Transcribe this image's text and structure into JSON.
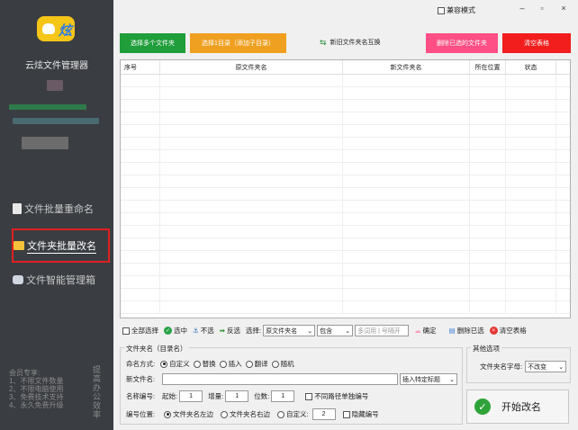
{
  "sidebar": {
    "logo_text": "炫",
    "app_name": "云炫文件管理器",
    "nav": [
      {
        "label": "文件批量重命名"
      },
      {
        "label": "文件夹批量改名"
      },
      {
        "label": "文件智能管理箱"
      }
    ],
    "promo_lines": [
      "会员专享:",
      "1、不限文件数量",
      "2、不限电脑使用",
      "3、免费技术支持",
      "4、永久免费升级"
    ],
    "promo_vertical": "提高办公效率"
  },
  "window": {
    "compat_label": "兼容模式",
    "minimize": "–",
    "maximize": "▫",
    "close": "×"
  },
  "toolbar": {
    "select_folders": "选择多个文件夹",
    "select_dir": "选择1目录（添加子目录）",
    "swap_label": "新旧文件夹名互换",
    "delete_selected": "删除已选的文件夹",
    "clear_table": "清空表格"
  },
  "table": {
    "columns": [
      "序号",
      "原文件夹名",
      "新文件夹名",
      "所在位置",
      "状态"
    ]
  },
  "actions": {
    "select_all": "全部选择",
    "select": "选中",
    "deselect": "不选",
    "invert": "反选",
    "choose_label": "选择:",
    "choose_field": "原文件夹名",
    "match_mode": "包含",
    "keywords_placeholder": "多词用 | 号隔开",
    "confirm": "确定",
    "delete_selected": "删除已选",
    "clear_table": "清空表格"
  },
  "naming": {
    "panel_title": "文件夹名（目录名）",
    "mode_label": "命名方式:",
    "modes": [
      "自定义",
      "替换",
      "插入",
      "翻译",
      "随机"
    ],
    "new_name_label": "新文件名:",
    "new_name_value": "",
    "insert_tag": "插入特定标题",
    "number_label": "名称编号:",
    "start_label": "起始:",
    "start_value": "1",
    "step_label": "增量:",
    "step_value": "1",
    "digits_label": "位数:",
    "digits_value": "1",
    "separate_label": "不同路径单独编号",
    "position_label": "编号位置:",
    "positions": [
      "文件夹名左边",
      "文件夹名右边",
      "自定义:"
    ],
    "custom_pos_value": "2",
    "hide_number_label": "隐藏编号"
  },
  "other": {
    "panel_title": "其他选项",
    "case_label": "文件夹名字母:",
    "case_value": "不改变"
  },
  "start_button": "开始改名",
  "colors": {
    "sidebar_bg": "#3a3d42",
    "green_btn": "#1f9e3a",
    "orange_btn": "#f0a020",
    "pink_btn": "#ff4f86",
    "red_btn": "#f21d1d",
    "active_border": "#e02020"
  }
}
